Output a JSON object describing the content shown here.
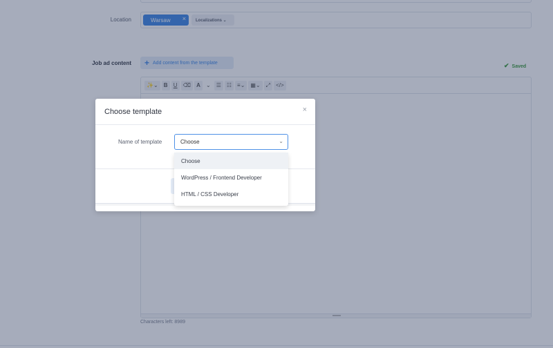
{
  "form": {
    "location_label": "Location",
    "location_tag": "Warsaw",
    "location_tag_remove": "×",
    "localizations_label": "Localizations ⌄",
    "job_ad_label": "Job ad content",
    "add_template_label": "Add content from the template",
    "saved_label": "Saved",
    "characters_left": "Characters left: 8989"
  },
  "toolbar": {
    "magic": "✨⌄",
    "bold": "B",
    "underline": "U",
    "eraser": "⌫",
    "font": "A",
    "font_dd": "⌄",
    "ul": "☰",
    "ol": "☷",
    "align": "≡⌄",
    "table": "▦⌄",
    "fullscreen": "⤢",
    "code": "</>"
  },
  "modal": {
    "title": "Choose template",
    "close": "×",
    "field_label": "Name of template",
    "selected_value": "Choose",
    "options": [
      "Choose",
      "WordPress / Frontend Developer",
      "HTML / CSS Developer"
    ]
  },
  "colors": {
    "accent": "#3b86e6",
    "saved": "#3a9a3a",
    "overlay": "#2c3a5c"
  }
}
